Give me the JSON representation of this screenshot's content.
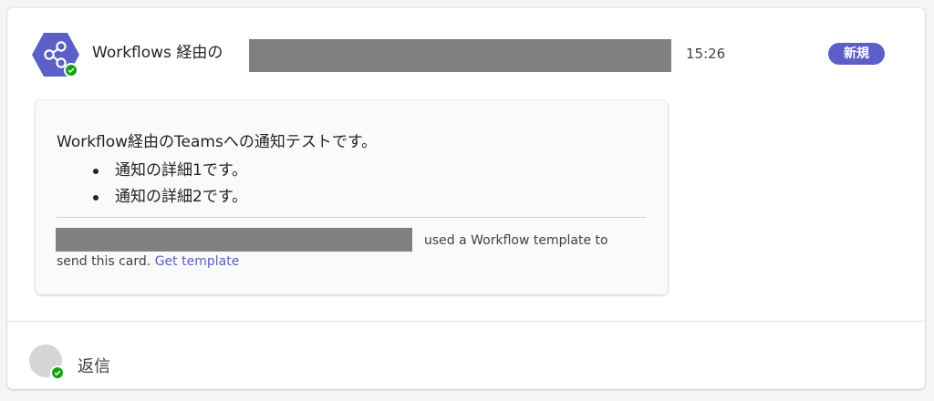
{
  "message": {
    "sender_prefix": "Workflows 経由の",
    "sender_name_redacted": true,
    "timestamp": "15:26",
    "new_badge": "新規",
    "avatar_icon": "share-nodes-icon",
    "status": "available"
  },
  "card": {
    "intro": "Workflow経由のTeamsへの通知テストです。",
    "bullets": [
      "通知の詳細1です。",
      "通知の詳細2です。"
    ],
    "footer_user_redacted": true,
    "footer_line1": "used a Workflow template to",
    "footer_line2": "send this card.",
    "template_link": "Get template"
  },
  "reply": {
    "label": "返信"
  },
  "colors": {
    "accent": "#5b5fc7",
    "presence_available": "#13a10e",
    "redaction": "#808080"
  }
}
